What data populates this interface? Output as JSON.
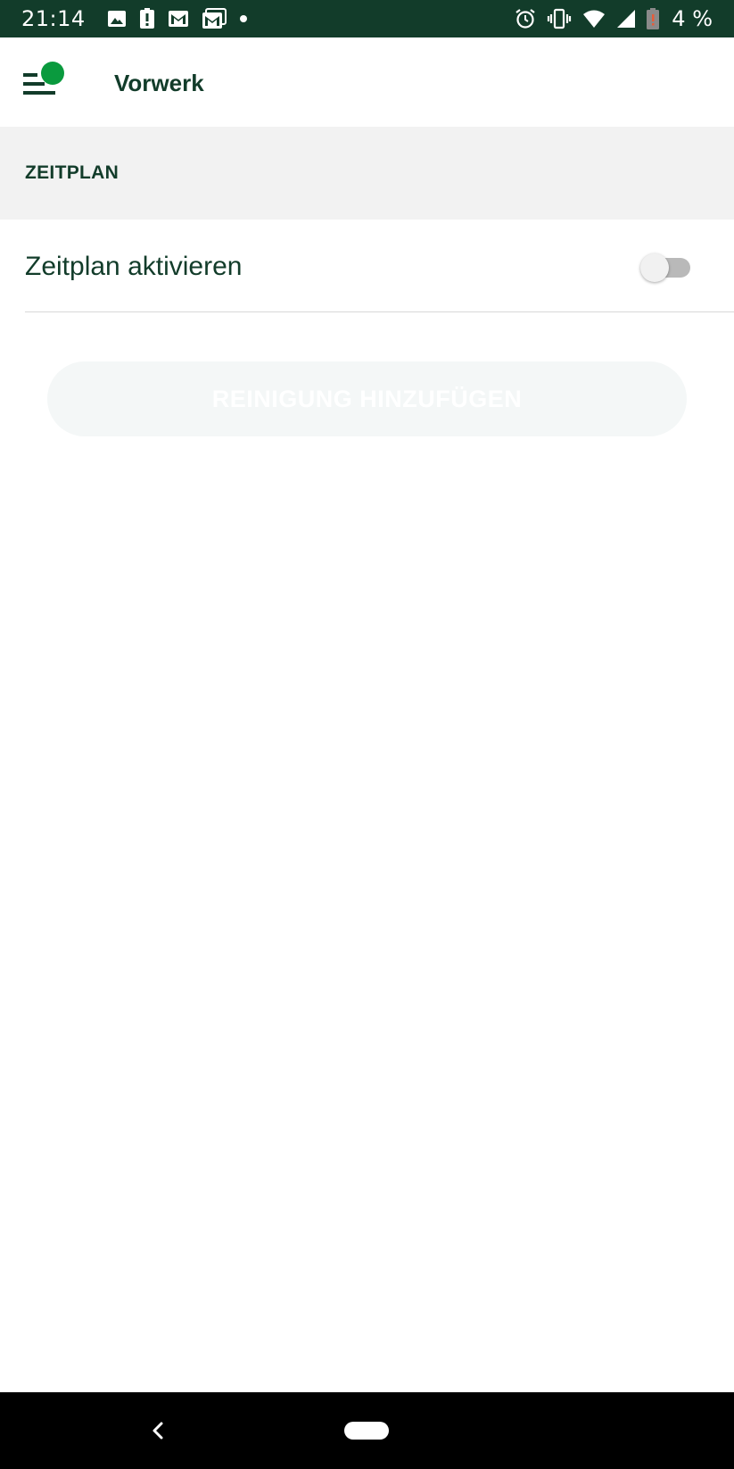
{
  "status_bar": {
    "time": "21:14",
    "battery_text": "4 %",
    "left_icons": [
      "image-icon",
      "alert-icon",
      "gmail-icon",
      "gmail-outline-icon",
      "dot-icon"
    ],
    "right_icons": [
      "alarm-icon",
      "vibrate-icon",
      "wifi-icon",
      "signal-icon",
      "battery-low-icon"
    ],
    "background_color": "#123c2a"
  },
  "app_bar": {
    "title": "Vorwerk",
    "menu_icon": "menu-icon",
    "accent_color": "#0a9a3e"
  },
  "section": {
    "header": "ZEITPLAN"
  },
  "schedule_toggle": {
    "label": "Zeitplan aktivieren",
    "enabled": false
  },
  "add_cleaning_button": {
    "label": "REINIGUNG HINZUFÜGEN",
    "disabled": true
  },
  "nav_bar": {
    "back_icon": "back-chevron-icon",
    "home_icon": "home-pill-icon"
  }
}
